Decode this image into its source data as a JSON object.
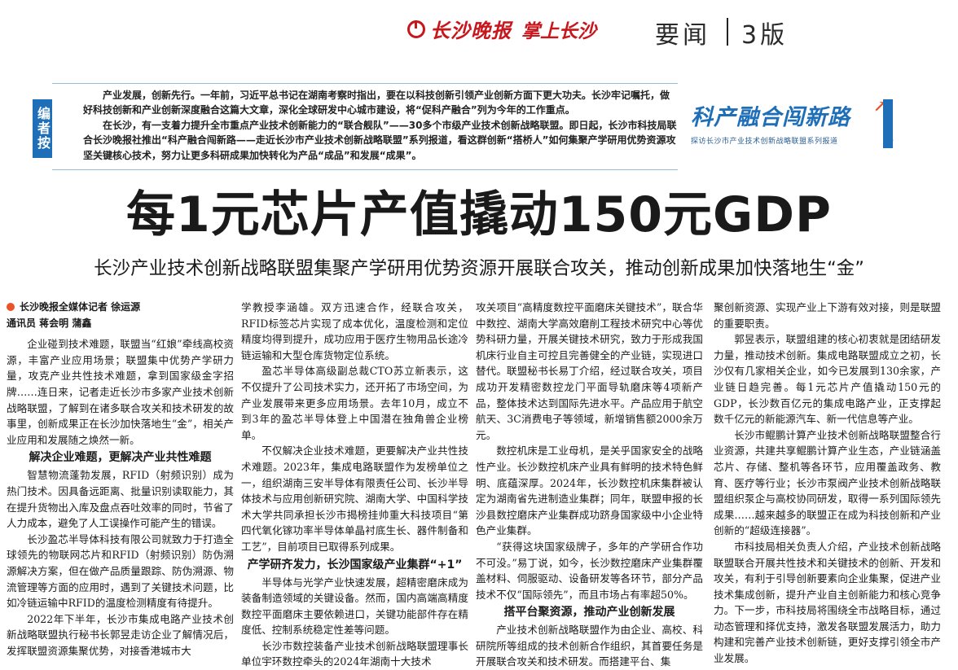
{
  "masthead": {
    "paper_name": "长沙晚报",
    "app_name": "掌上长沙",
    "section": "要闻",
    "page": "3版"
  },
  "editor_note": {
    "tag": "编者按",
    "paragraphs": [
      "产业发展，创新先行。一年前，习近平总书记在湖南考察时指出，要在以科技创新引领产业创新方面下更大功夫。长沙牢记嘱托，做好科技创新和产业创新深度融合这篇大文章，深化全球研发中心城市建设，将“促科产融合”列为今年的工作重点。",
      "在长沙，有一支着力提升全市重点产业技术创新能力的“联合舰队”——30多个市级产业技术创新战略联盟。即日起，长沙市科技局联合长沙晚报社推出“科产融合闯新路——走近长沙市产业技术创新战略联盟”系列报道，看这群创新“搭桥人”如何集聚产学研用优势资源攻坚关键核心技术，努力让更多科研成果加快转化为产品“成品”和发展“成果”。"
    ]
  },
  "series": {
    "title": "科产融合闯新路",
    "subtitle": "探访长沙市产业技术创新战略联盟系列报道",
    "number": "1"
  },
  "headline": "每1元芯片产值撬动150元GDP",
  "subheadline": "长沙产业技术创新战略联盟集聚产学研用优势资源开展联合攻关，推动创新成果加快落地生“金”",
  "byline": {
    "reporter": "长沙晚报全媒体记者 徐运源",
    "correspondents": "通讯员 蒋会明 蒲鑫"
  },
  "columns": {
    "c1": [
      {
        "type": "p",
        "text": "企业碰到技术难题，联盟当“红娘”牵线高校资源，丰富产业应用场景；联盟集中优势产学研力量，攻克产业共性技术难题，拿到国家级金字招牌……连日来，记者走近长沙市多家产业技术创新战略联盟，了解到在诸多联合攻关和技术研发的故事里，创新成果正在长沙加快落地生“金”，相关产业应用和发展随之焕然一新。"
      },
      {
        "type": "h",
        "text": "解决企业难题，更解决产业共性难题"
      },
      {
        "type": "p",
        "text": "智慧物流蓬勃发展，RFID（射频识别）成为热门技术。因具备远距离、批量识别读取能力，其在提升货物出入库及盘点吞吐效率的同时，节省了人力成本，避免了人工误操作可能产生的错误。"
      },
      {
        "type": "p",
        "text": "长沙盈芯半导体科技有限公司就致力于打造全球领先的物联网芯片和RFID（射频识别）防伪溯源解决方案，但在做产品质量跟踪、防伪溯源、物流管理等方面的应用时，遇到了关键技术问题，比如冷链运输中RFID的温度检测精度有待提升。"
      },
      {
        "type": "p",
        "text": "2022年下半年，长沙市集成电路产业技术创新战略联盟执行秘书长郭昱走访企业了解情况后，发挥联盟资源集聚优势，对接香港城市大"
      }
    ],
    "c2": [
      {
        "type": "cont",
        "text": "学教授李涵雄。双方迅速合作，经联合攻关，RFID标签芯片实现了成本优化，温度检测和定位精度均得到提升，成功应用于医疗生物用品长途冷链运输和大型仓库货物定位系统。"
      },
      {
        "type": "p",
        "text": "盈芯半导体高级副总裁CTO苏立新表示，这不仅提升了公司技术实力，还开拓了市场空间，为产业发展带来更多应用场景。去年10月，成立不到3年的盈芯半导体登上中国潜在独角兽企业榜单。"
      },
      {
        "type": "p",
        "text": "不仅解决企业技术难题，更要解决产业共性技术难题。2023年，集成电路联盟作为发榜单位之一，组织湖南三安半导体有限责任公司、长沙半导体技术与应用创新研究院、湖南大学、中国科学技术大学共同承担长沙市揭榜挂帅重大科技项目“第四代氧化镓功率半导体单晶衬底生长、器件制备和工艺”，目前项目已取得系列成果。"
      },
      {
        "type": "h",
        "text": "产学研齐发力，长沙国家级产业集群“+1”"
      },
      {
        "type": "p",
        "text": "半导体与光学产业快速发展，超精密磨床成为装备制造领域的关键设备。然而，国内高端高精度数控平面磨床主要依赖进口，关键功能部件存在精度低、控制系统稳定性差等问题。"
      },
      {
        "type": "p",
        "text": "长沙市数控装备产业技术创新战略联盟理事长单位宇环数控牵头的2024年湖南十大技术"
      }
    ],
    "c3": [
      {
        "type": "cont",
        "text": "攻关项目“高精度数控平面磨床关键技术”，联合华中数控、湖南大学高效磨削工程技术研究中心等优势科研力量，开展关键技术研究，致力于形成我国机床行业自主可控且完善健全的产业链，实现进口替代。联盟秘书长易丁介绍，经过联合攻关，项目成功开发精密数控龙门平面导轨磨床等4项新产品，整体技术达到国际先进水平。产品应用于航空航天、3C消费电子等领域，新增销售额2000余万元。"
      },
      {
        "type": "p",
        "text": "数控机床是工业母机，是关乎国家安全的战略性产业。长沙数控机床产业具有鲜明的技术特色鲜明、底蕴深厚。2024年，长沙数控机床集群被认定为湖南省先进制造业集群；同年，联盟申报的长沙县数控磨床产业集群成功跻身国家级中小企业特色产业集群。"
      },
      {
        "type": "p",
        "text": "“获得这块国家级牌子，多年的产学研合作功不可没。”易丁说，如今，长沙数控磨床产业集群覆盖材料、伺服驱动、设备研发等各环节，部分产品技术不仅“国际领先”，而且市场占有率超50%。"
      },
      {
        "type": "h",
        "text": "搭平台聚资源，推动产业创新发展"
      },
      {
        "type": "p",
        "text": "产业技术创新战略联盟作为由企业、高校、科研院所等组成的技术创新合作组织，其首要任务是开展联合攻关和技术研发。而搭建平台、集"
      }
    ],
    "c4": [
      {
        "type": "cont",
        "text": "聚创新资源、实现产业上下游有效对接，则是联盟的重要职责。"
      },
      {
        "type": "p",
        "text": "郭昱表示，联盟组建的核心初衷就是团结研发力量，推动技术创新。集成电路联盟成立之初，长沙仅有几家相关企业，如今已发展到130余家，产业链日趋完善。每1元芯片产值撬动150元的GDP，长沙数百亿元的集成电路产业，正支撑起数千亿元的新能源汽车、新一代信息等产业。"
      },
      {
        "type": "p",
        "text": "长沙市鲲鹏计算产业技术创新战略联盟整合行业资源，共建共享鲲鹏计算产业生态，产业链涵盖芯片、存储、整机等各环节，应用覆盖政务、教育、医疗等行业；长沙市泵阀产业技术创新战略联盟组织泵企与高校协同研发，取得一系列国际领先成果……越来越多的联盟正在成为科技创新和产业创新的“超级连接器”。"
      },
      {
        "type": "p",
        "text": "市科技局相关负责人介绍，产业技术创新战略联盟联合开展共性技术和关键技术的创新、开发和攻关，有利于引导创新要素向企业集聚，促进产业技术集成创新，提升产业自主创新能力和核心竞争力。下一步，市科技局将围绕全市战略目标，通过动态管理和择优支持，激发各联盟发展活力，助力构建和完善产业技术创新链，更好支撑引领全市产业发展。"
      }
    ]
  }
}
